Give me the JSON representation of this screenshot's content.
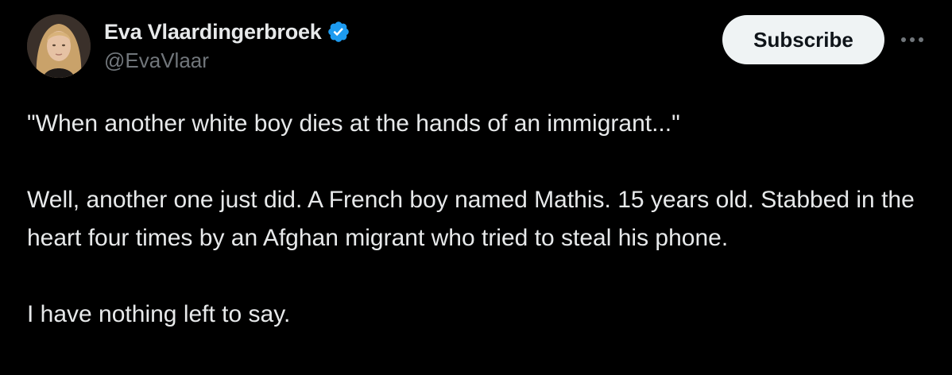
{
  "author": {
    "display_name": "Eva Vlaardingerbroek",
    "handle": "@EvaVlaar",
    "verified": true,
    "verified_icon": "verified-badge-icon",
    "avatar_icon": "avatar-photo"
  },
  "actions": {
    "subscribe_label": "Subscribe",
    "more_icon": "more-horizontal-icon"
  },
  "tweet": {
    "paragraphs": [
      "\"When another white boy dies at the hands of an immigrant...\"",
      "Well, another one just did. A French boy named Mathis. 15 years old. Stabbed in the heart four times by an Afghan migrant who tried to steal his phone.",
      "I have nothing left to say."
    ]
  },
  "colors": {
    "background": "#000000",
    "text_primary": "#e7e9ea",
    "text_secondary": "#71767b",
    "verified_blue": "#1d9bf0",
    "button_bg": "#eff3f4",
    "button_text": "#0f1419"
  }
}
